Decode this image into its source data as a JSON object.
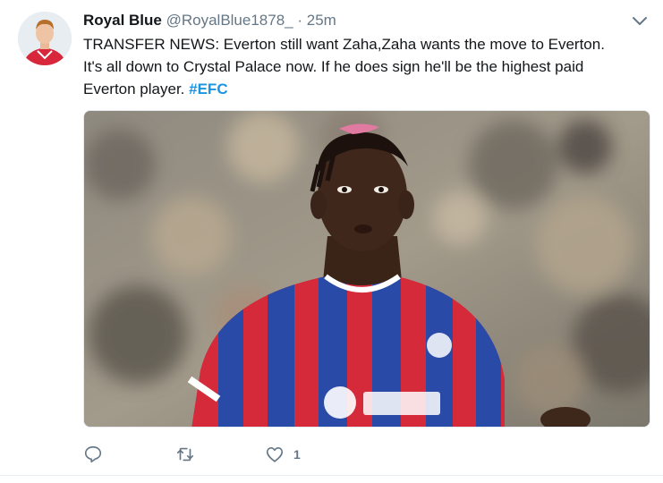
{
  "tweet": {
    "author_name": "Royal Blue",
    "handle": "@RoyalBlue1878_",
    "separator": "·",
    "time": "25m",
    "text": "TRANSFER NEWS: Everton still want Zaha,Zaha wants the move to Everton. It's all down to Crystal Palace now. If he does sign he'll be the highest paid Everton player.",
    "hashtag": "#EFC",
    "media_icon": "photo-of-footballer",
    "actions": {
      "reply_icon": "reply-icon",
      "retweet_icon": "retweet-icon",
      "like_icon": "heart-icon",
      "like_count": "1"
    }
  },
  "colors": {
    "link": "#1b95e0",
    "muted": "#657786",
    "text": "#14171a",
    "border": "#e6ecf0"
  }
}
